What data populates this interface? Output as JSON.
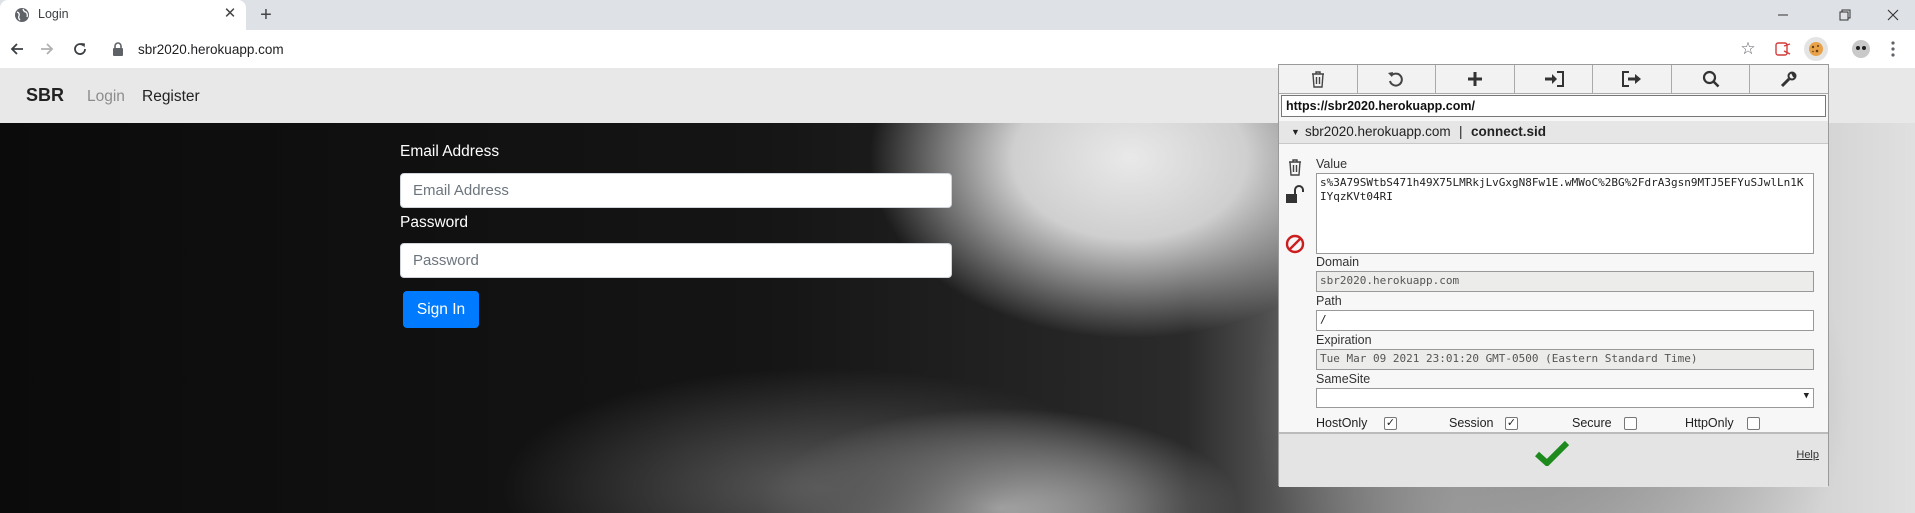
{
  "browser": {
    "tab_title": "Login",
    "url": "sbr2020.herokuapp.com"
  },
  "navbar": {
    "brand": "SBR",
    "login": "Login",
    "register": "Register"
  },
  "form": {
    "email_label": "Email Address",
    "email_placeholder": "Email Address",
    "password_label": "Password",
    "password_placeholder": "Password",
    "signin": "Sign In"
  },
  "cookie_editor": {
    "url": "https://sbr2020.herokuapp.com/",
    "cookie_domain": "sbr2020.herokuapp.com",
    "separator": "|",
    "cookie_name": "connect.sid",
    "value_label": "Value",
    "value": "s%3A79SWtbS471h49X75LMRkjLvGxgN8Fw1E.wMWoC%2BG%2FdrA3gsn9MTJ5EFYuSJwlLn1KIYqzKVt04RI",
    "domain_label": "Domain",
    "domain_value": "sbr2020.herokuapp.com",
    "path_label": "Path",
    "path_value": "/",
    "expiration_label": "Expiration",
    "expiration_value": "Tue Mar 09 2021 23:01:20 GMT-0500 (Eastern Standard Time)",
    "samesite_label": "SameSite",
    "samesite_value": "",
    "flags": {
      "hostonly": "HostOnly",
      "session": "Session",
      "secure": "Secure",
      "httponly": "HttpOnly"
    },
    "checked": {
      "hostonly": true,
      "session": true,
      "secure": false,
      "httponly": false
    },
    "help": "Help",
    "colors": {
      "save": "#1e8a1e",
      "block": "#cc1e1e",
      "accent": "#007bff"
    }
  }
}
